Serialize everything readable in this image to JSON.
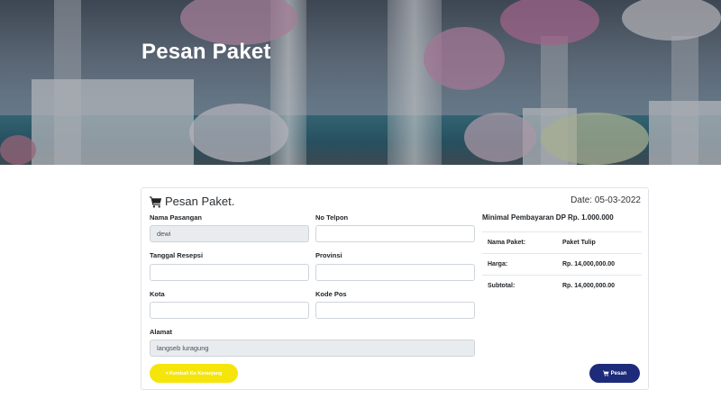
{
  "hero": {
    "title": "Pesan Paket"
  },
  "card": {
    "title": "Pesan Paket.",
    "date_label": "Date: 05-03-2022"
  },
  "form": {
    "nama_pasangan": {
      "label": "Nama Pasangan",
      "value": "dewi"
    },
    "no_telpon": {
      "label": "No Telpon",
      "value": ""
    },
    "tanggal_resepsi": {
      "label": "Tanggal Resepsi",
      "value": ""
    },
    "provinsi": {
      "label": "Provinsi",
      "value": ""
    },
    "kota": {
      "label": "Kota",
      "value": ""
    },
    "kode_pos": {
      "label": "Kode Pos",
      "value": ""
    },
    "alamat": {
      "label": "Alamat",
      "value": "langseb luragung"
    }
  },
  "summary": {
    "min_dp": "Minimal Pembayaran DP Rp. 1.000.000",
    "rows": [
      {
        "key": "Nama Paket:",
        "value": "Paket Tulip"
      },
      {
        "key": "Harga:",
        "value": "Rp. 14,000,000.00"
      },
      {
        "key": "Subtotal:",
        "value": "Rp. 14,000,000.00"
      }
    ]
  },
  "buttons": {
    "back_icon": "«",
    "back_label": "Kembali Ke Keranjang",
    "order_label": "Pesan"
  },
  "colors": {
    "back_button": "#f5e50b",
    "order_button": "#1d2b7a"
  },
  "icons": {
    "card_title": "shopping-cart-icon",
    "back_button": "double-chevron-left-icon",
    "order_button": "shopping-cart-icon"
  }
}
